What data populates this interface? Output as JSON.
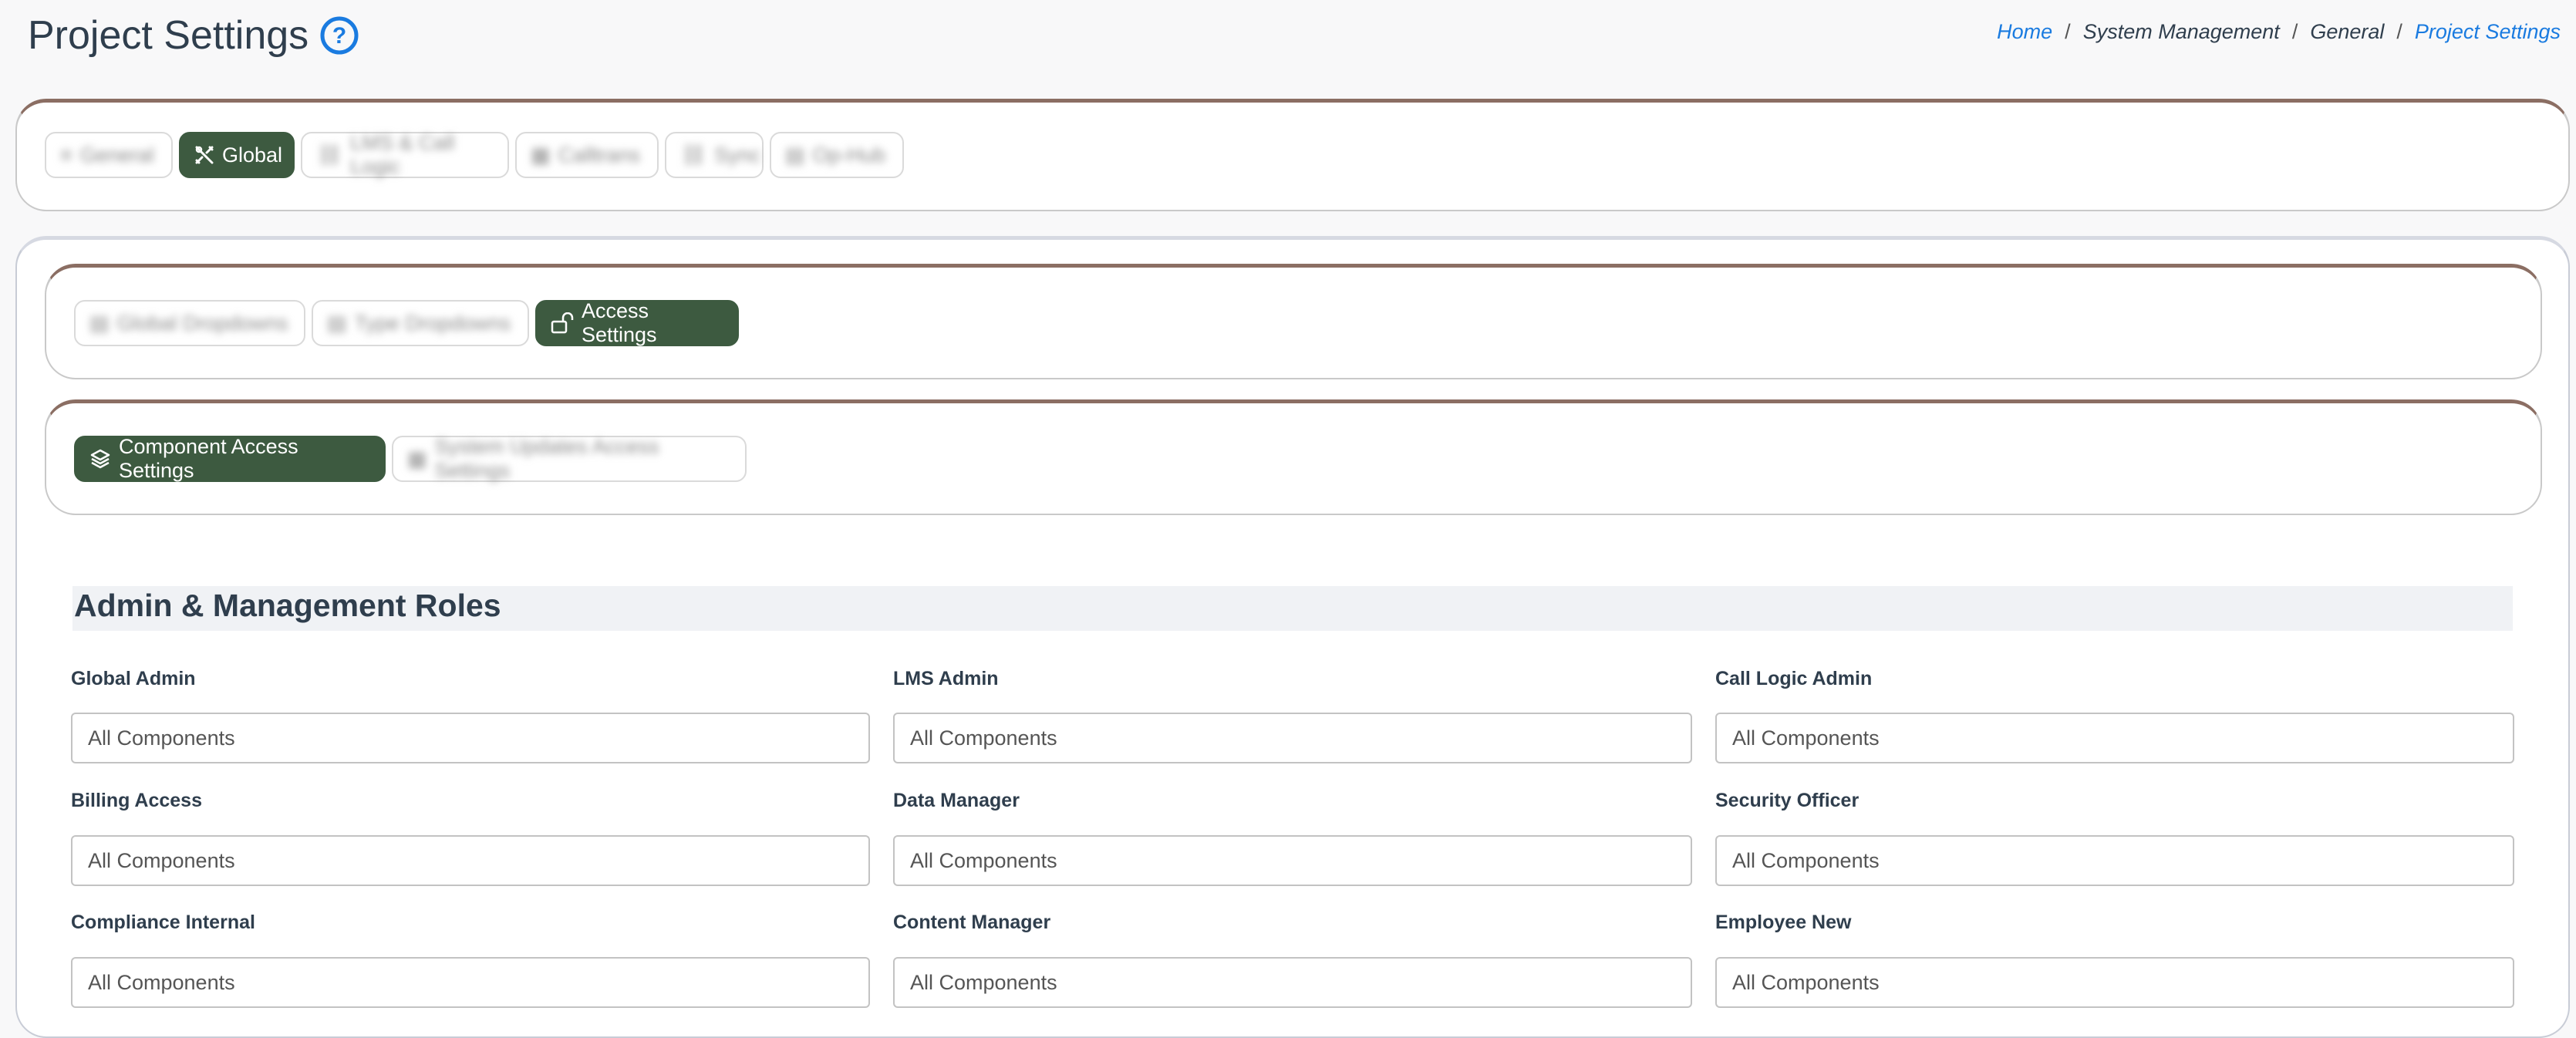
{
  "header": {
    "title": "Project Settings",
    "breadcrumb": [
      "Home",
      "System Management",
      "General",
      "Project Settings"
    ]
  },
  "top_tabs": [
    {
      "label": "General",
      "icon": "sliders-icon",
      "active": false
    },
    {
      "label": "Global",
      "icon": "tools-icon",
      "active": true
    },
    {
      "label": "LMS & Call Logic",
      "icon": "link-icon",
      "active": false
    },
    {
      "label": "Calltrans",
      "icon": "grid-icon",
      "active": false
    },
    {
      "label": "Sync",
      "icon": "link-icon",
      "active": false
    },
    {
      "label": "Op-Hub",
      "icon": "doc-icon",
      "active": false
    }
  ],
  "sub_tabs": [
    {
      "label": "Global Dropdowns",
      "icon": "list-icon",
      "active": false
    },
    {
      "label": "Type Dropdowns",
      "icon": "list-icon",
      "active": false
    },
    {
      "label": "Access Settings",
      "icon": "unlock-icon",
      "active": true
    }
  ],
  "access_tabs": [
    {
      "label": "Component Access Settings",
      "icon": "layers-icon",
      "active": true
    },
    {
      "label": "System Updates Access Settings",
      "icon": "grid-icon",
      "active": false
    }
  ],
  "section": {
    "title": "Admin & Management Roles"
  },
  "fields": [
    {
      "label": "Global Admin",
      "placeholder": "All Components"
    },
    {
      "label": "LMS Admin",
      "placeholder": "All Components"
    },
    {
      "label": "Call Logic Admin",
      "placeholder": "All Components"
    },
    {
      "label": "Billing Access",
      "placeholder": "All Components"
    },
    {
      "label": "Data Manager",
      "placeholder": "All Components"
    },
    {
      "label": "Security Officer",
      "placeholder": "All Components"
    },
    {
      "label": "Compliance Internal",
      "placeholder": "All Components"
    },
    {
      "label": "Content Manager",
      "placeholder": "All Components"
    },
    {
      "label": "Employee New",
      "placeholder": "All Components"
    }
  ],
  "colors": {
    "accent_green": "#3d5a40",
    "card_top_border": "#8b6e63",
    "link_blue": "#1a7be0"
  }
}
